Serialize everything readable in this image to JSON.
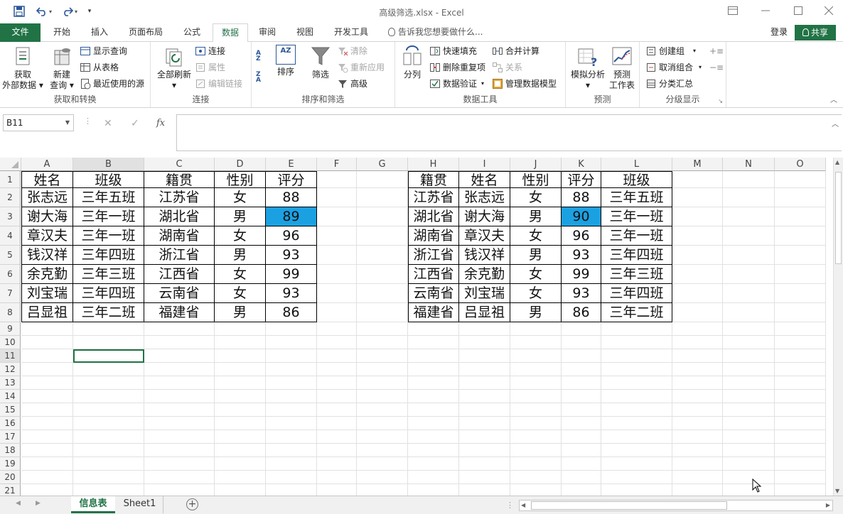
{
  "titlebar": {
    "title": "高级筛选.xlsx - Excel",
    "save_icon": "save-icon",
    "undo_icon": "undo-icon",
    "redo_icon": "redo-icon",
    "customize_icon": "customize-qat-icon",
    "ribbon_display_icon": "ribbon-display-options-icon",
    "minimize_icon": "minimize-icon",
    "maximize_icon": "maximize-icon",
    "close_icon": "close-icon"
  },
  "tabs": {
    "file": "文件",
    "home": "开始",
    "insert": "插入",
    "page_layout": "页面布局",
    "formulas": "公式",
    "data": "数据",
    "review": "审阅",
    "view": "视图",
    "developer": "开发工具",
    "tell_me": "告诉我您想要做什么...",
    "login": "登录",
    "share": "共享"
  },
  "ribbon": {
    "get_transform": {
      "label": "获取和转换",
      "get_external_1": "获取",
      "get_external_2": "外部数据",
      "new_query_1": "新建",
      "new_query_2": "查询",
      "show_queries": "显示查询",
      "from_table": "从表格",
      "recent_sources": "最近使用的源"
    },
    "connections": {
      "label": "连接",
      "refresh_all": "全部刷新",
      "connections": "连接",
      "properties": "属性",
      "edit_links": "编辑链接"
    },
    "sort_filter": {
      "label": "排序和筛选",
      "sort_az": "AZ",
      "sort": "排序",
      "filter": "筛选",
      "clear": "清除",
      "reapply": "重新应用",
      "advanced": "高级"
    },
    "data_tools": {
      "label": "数据工具",
      "text_to_columns": "分列",
      "flash_fill": "快速填充",
      "remove_duplicates": "删除重复项",
      "data_validation": "数据验证",
      "consolidate": "合并计算",
      "relationships": "关系",
      "manage_data_model": "管理数据模型"
    },
    "forecast": {
      "label": "预测",
      "what_if_1": "模拟分析",
      "forecast_sheet_1": "预测",
      "forecast_sheet_2": "工作表"
    },
    "outline": {
      "label": "分级显示",
      "group": "创建组",
      "ungroup": "取消组合",
      "subtotal": "分类汇总"
    }
  },
  "formula_bar": {
    "name_box": "B11",
    "cancel": "✕",
    "enter": "✓",
    "fx": "fx",
    "formula": ""
  },
  "grid": {
    "columns": [
      "A",
      "B",
      "C",
      "D",
      "E",
      "F",
      "G",
      "H",
      "I",
      "J",
      "K",
      "L",
      "M",
      "N",
      "O"
    ],
    "rows": [
      "1",
      "2",
      "3",
      "4",
      "5",
      "6",
      "7",
      "8",
      "9",
      "10",
      "11",
      "12",
      "13",
      "14",
      "15",
      "16",
      "17",
      "18",
      "19",
      "20",
      "21"
    ],
    "table1": {
      "header": [
        "姓名",
        "班级",
        "籍贯",
        "性别",
        "评分"
      ],
      "rows": [
        [
          "张志远",
          "三年五班",
          "江苏省",
          "女",
          "88"
        ],
        [
          "谢大海",
          "三年一班",
          "湖北省",
          "男",
          "89"
        ],
        [
          "章汉夫",
          "三年一班",
          "湖南省",
          "女",
          "96"
        ],
        [
          "钱汉祥",
          "三年四班",
          "浙江省",
          "男",
          "93"
        ],
        [
          "余克勤",
          "三年三班",
          "江西省",
          "女",
          "99"
        ],
        [
          "刘宝瑞",
          "三年四班",
          "云南省",
          "女",
          "93"
        ],
        [
          "吕显祖",
          "三年二班",
          "福建省",
          "男",
          "86"
        ]
      ]
    },
    "table2": {
      "header": [
        "籍贯",
        "姓名",
        "性别",
        "评分",
        "班级"
      ],
      "rows": [
        [
          "江苏省",
          "张志远",
          "女",
          "88",
          "三年五班"
        ],
        [
          "湖北省",
          "谢大海",
          "男",
          "90",
          "三年一班"
        ],
        [
          "湖南省",
          "章汉夫",
          "女",
          "96",
          "三年一班"
        ],
        [
          "浙江省",
          "钱汉祥",
          "男",
          "93",
          "三年四班"
        ],
        [
          "江西省",
          "余克勤",
          "女",
          "99",
          "三年三班"
        ],
        [
          "云南省",
          "刘宝瑞",
          "女",
          "93",
          "三年四班"
        ],
        [
          "福建省",
          "吕显祖",
          "男",
          "86",
          "三年二班"
        ]
      ]
    },
    "highlight_color": "#1ba1e2"
  },
  "sheets": {
    "active": "信息表",
    "other": "Sheet1",
    "add_icon": "add-sheet-icon"
  },
  "colors": {
    "accent": "#217346"
  }
}
